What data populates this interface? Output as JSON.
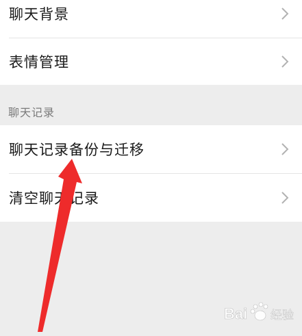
{
  "group_top": {
    "items": [
      {
        "label": "聊天背景"
      },
      {
        "label": "表情管理"
      }
    ]
  },
  "chat_history": {
    "header": "聊天记录",
    "items": [
      {
        "label": "聊天记录备份与迁移"
      },
      {
        "label": "清空聊天记录"
      }
    ]
  },
  "annotation": {
    "arrow_color": "#ee2b2b"
  },
  "watermark": {
    "brand": "Bai",
    "suffix": "经验"
  },
  "colors": {
    "background": "#ededed",
    "row_background": "#ffffff",
    "chevron": "#b2b2b2"
  },
  "icons": {
    "row_chevron": "chevron-right-icon"
  }
}
